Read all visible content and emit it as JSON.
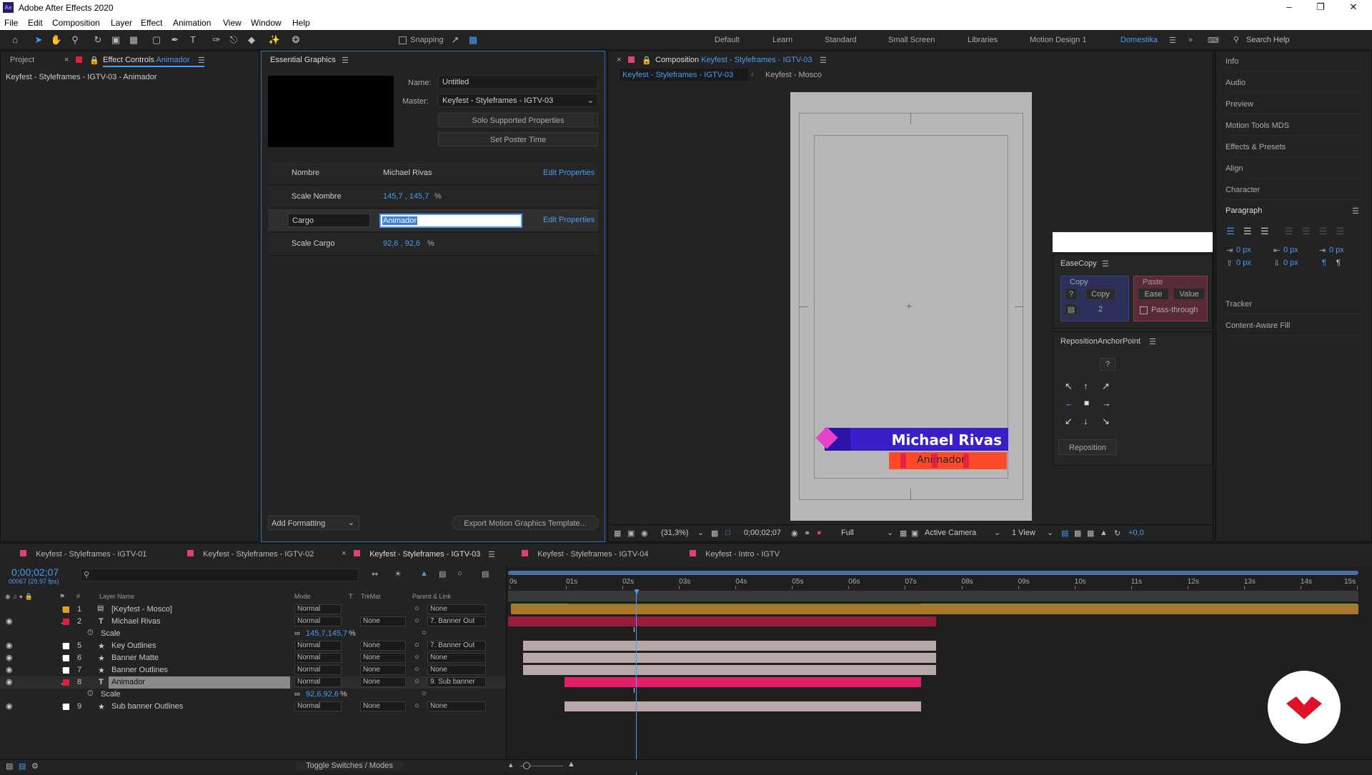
{
  "app": {
    "title": "Adobe After Effects 2020",
    "icon": "ae-app-icon"
  },
  "menu": [
    "File",
    "Edit",
    "Composition",
    "Layer",
    "Effect",
    "Animation",
    "View",
    "Window",
    "Help"
  ],
  "toolbar": {
    "snapping": "Snapping",
    "workspaces": [
      "Default",
      "Learn",
      "Standard",
      "Small Screen",
      "Libraries",
      "Motion Design 1",
      "Domestika"
    ],
    "active_workspace": "Domestika",
    "search_placeholder": "Search Help"
  },
  "left_panel": {
    "tab_project": "Project",
    "tab_effect_prefix": "Effect Controls",
    "tab_effect_layer": "Animador",
    "breadcrumb": "Keyfest - Styleframes - IGTV-03 - Animador"
  },
  "eg": {
    "title": "Essential Graphics",
    "name_label": "Name:",
    "name_value": "Untitled",
    "master_label": "Master:",
    "master_value": "Keyfest - Styleframes - IGTV-03",
    "solo_btn": "Solo Supported Properties",
    "poster_btn": "Set Poster Time",
    "rows": [
      {
        "label": "Nombre",
        "value": "Michael Rivas",
        "action": "Edit Properties"
      },
      {
        "label": "Scale Nombre",
        "value": "145,7 , 145,7",
        "unit": "%"
      },
      {
        "label": "Cargo",
        "value": "Animador",
        "action": "Edit Properties"
      },
      {
        "label": "Scale Cargo",
        "value": "92,6 , 92,6",
        "unit": "%"
      }
    ],
    "add_formatting": "Add Formatting",
    "export_btn": "Export Motion Graphics Template..."
  },
  "comp": {
    "tab_prefix": "Composition",
    "tab_name": "Keyfest - Styleframes - IGTV-03",
    "crumb1": "Keyfest - Styleframes - IGTV-03",
    "crumb2": "Keyfest - Mosco",
    "name_text": "Michael Rivas",
    "cargo_text": "Animador",
    "zoom": "(31,3%)",
    "time": "0;00;02;07",
    "resolution": "Full",
    "camera": "Active Camera",
    "views": "1 View",
    "exposure": "+0,0"
  },
  "easecopy": {
    "title": "EaseCopy",
    "copy_group": "Copy",
    "paste_group": "Paste",
    "q": "?",
    "copy_btn": "Copy",
    "count": "2",
    "ease_btn": "Ease",
    "value_btn": "Value",
    "passthrough": "Pass-through"
  },
  "reposition": {
    "title": "RepositionAnchorPoint",
    "q": "?",
    "btn": "Reposition"
  },
  "right_panels": [
    "Info",
    "Audio",
    "Preview",
    "Motion Tools MDS",
    "Effects & Presets",
    "Align",
    "Character"
  ],
  "paragraph": {
    "title": "Paragraph",
    "px_values": [
      "0 px",
      "0 px",
      "0 px",
      "0 px",
      "0 px"
    ]
  },
  "right_panels_bottom": [
    "Tracker",
    "Content-Aware Fill"
  ],
  "timeline": {
    "tabs": [
      "Keyfest - Styleframes - IGTV-01",
      "Keyfest - Styleframes - IGTV-02",
      "Keyfest - Styleframes - IGTV-03",
      "Keyfest - Styleframes - IGTV-04",
      "Keyfest - Intro - IGTV"
    ],
    "tab_colors": [
      "#e0407a",
      "#e0407a",
      "#e0407a",
      "#e0407a",
      "#e0407a"
    ],
    "active_tab": 2,
    "timecode": "0;00;02;07",
    "fps": "00067 (29.97 fps)",
    "headers": {
      "num": "#",
      "name": "Layer Name",
      "mode": "Mode",
      "t": "T",
      "trkmat": "TrkMat",
      "parent": "Parent & Link"
    },
    "ticks": [
      "0s",
      "01s",
      "02s",
      "03s",
      "04s",
      "05s",
      "06s",
      "07s",
      "08s",
      "09s",
      "10s",
      "11s",
      "12s",
      "13s",
      "14s",
      "15s"
    ],
    "layers": [
      {
        "num": "1",
        "name": "[Keyfest - Mosco]",
        "mode": "Normal",
        "trkmat": "",
        "parent": "None",
        "color": "#e8a020",
        "type": "comp",
        "vis": false
      },
      {
        "num": "2",
        "name": "Michael Rivas",
        "mode": "Normal",
        "trkmat": "None",
        "parent": "7. Banner Out",
        "color": "#e0203a",
        "type": "T",
        "vis": true
      },
      {
        "sub": true,
        "name": "Scale",
        "value": "145,7,145,7",
        "unit": "%"
      },
      {
        "num": "5",
        "name": "Key Outlines",
        "mode": "Normal",
        "trkmat": "None",
        "parent": "7. Banner Out",
        "color": "#ffffff",
        "type": "star",
        "vis": true
      },
      {
        "num": "6",
        "name": "Banner Matte",
        "mode": "Normal",
        "trkmat": "None",
        "parent": "None",
        "color": "#ffffff",
        "type": "star",
        "vis": true
      },
      {
        "num": "7",
        "name": "Banner Outlines",
        "mode": "Normal",
        "trkmat": "None",
        "parent": "None",
        "color": "#ffffff",
        "type": "star",
        "vis": true
      },
      {
        "num": "8",
        "name": "Animador",
        "mode": "Normal",
        "trkmat": "None",
        "parent": "9. Sub banner",
        "color": "#e0203a",
        "type": "T",
        "vis": true
      },
      {
        "sub": true,
        "name": "Scale",
        "value": "92,6,92,6",
        "unit": "%"
      },
      {
        "num": "9",
        "name": "Sub banner Outlines",
        "mode": "Normal",
        "trkmat": "None",
        "parent": "None",
        "color": "#ffffff",
        "type": "star",
        "vis": true
      }
    ],
    "toggle": "Toggle Switches / Modes"
  }
}
